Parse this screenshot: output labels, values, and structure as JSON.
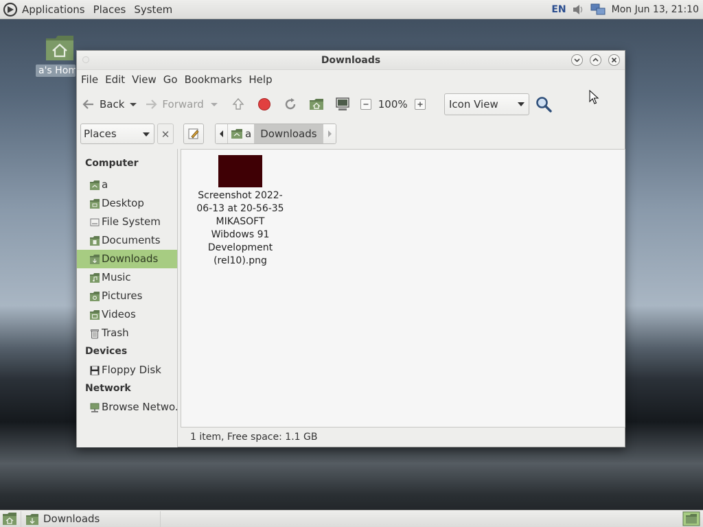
{
  "top_panel": {
    "menus": [
      "Applications",
      "Places",
      "System"
    ],
    "keyboard_layout": "EN",
    "clock": "Mon Jun 13, 21:10"
  },
  "desktop": {
    "home_icon_label": "a's Home"
  },
  "window": {
    "title": "Downloads",
    "menu": [
      "File",
      "Edit",
      "View",
      "Go",
      "Bookmarks",
      "Help"
    ],
    "toolbar": {
      "back": "Back",
      "forward": "Forward",
      "zoom": "100%",
      "view_mode": "Icon View"
    },
    "location": {
      "places_label": "Places",
      "breadcrumbs": [
        "a",
        "Downloads"
      ]
    },
    "sidebar": {
      "sections": [
        {
          "title": "Computer",
          "items": [
            "a",
            "Desktop",
            "File System",
            "Documents",
            "Downloads",
            "Music",
            "Pictures",
            "Videos",
            "Trash"
          ]
        },
        {
          "title": "Devices",
          "items": [
            "Floppy Disk"
          ]
        },
        {
          "title": "Network",
          "items": [
            "Browse Netwo..."
          ]
        }
      ],
      "selected": "Downloads"
    },
    "files": [
      {
        "name": "Screenshot 2022-06-13 at 20-56-35 MIKASOFT Wibdows 91 Development (rel10).png"
      }
    ],
    "status": "1 item, Free space: 1.1 GB"
  },
  "taskbar": {
    "tasks": [
      "Downloads"
    ]
  },
  "colors": {
    "selection": "#a7cc82",
    "thumbnail": "#3f0005",
    "panel": "#eeeeec"
  }
}
